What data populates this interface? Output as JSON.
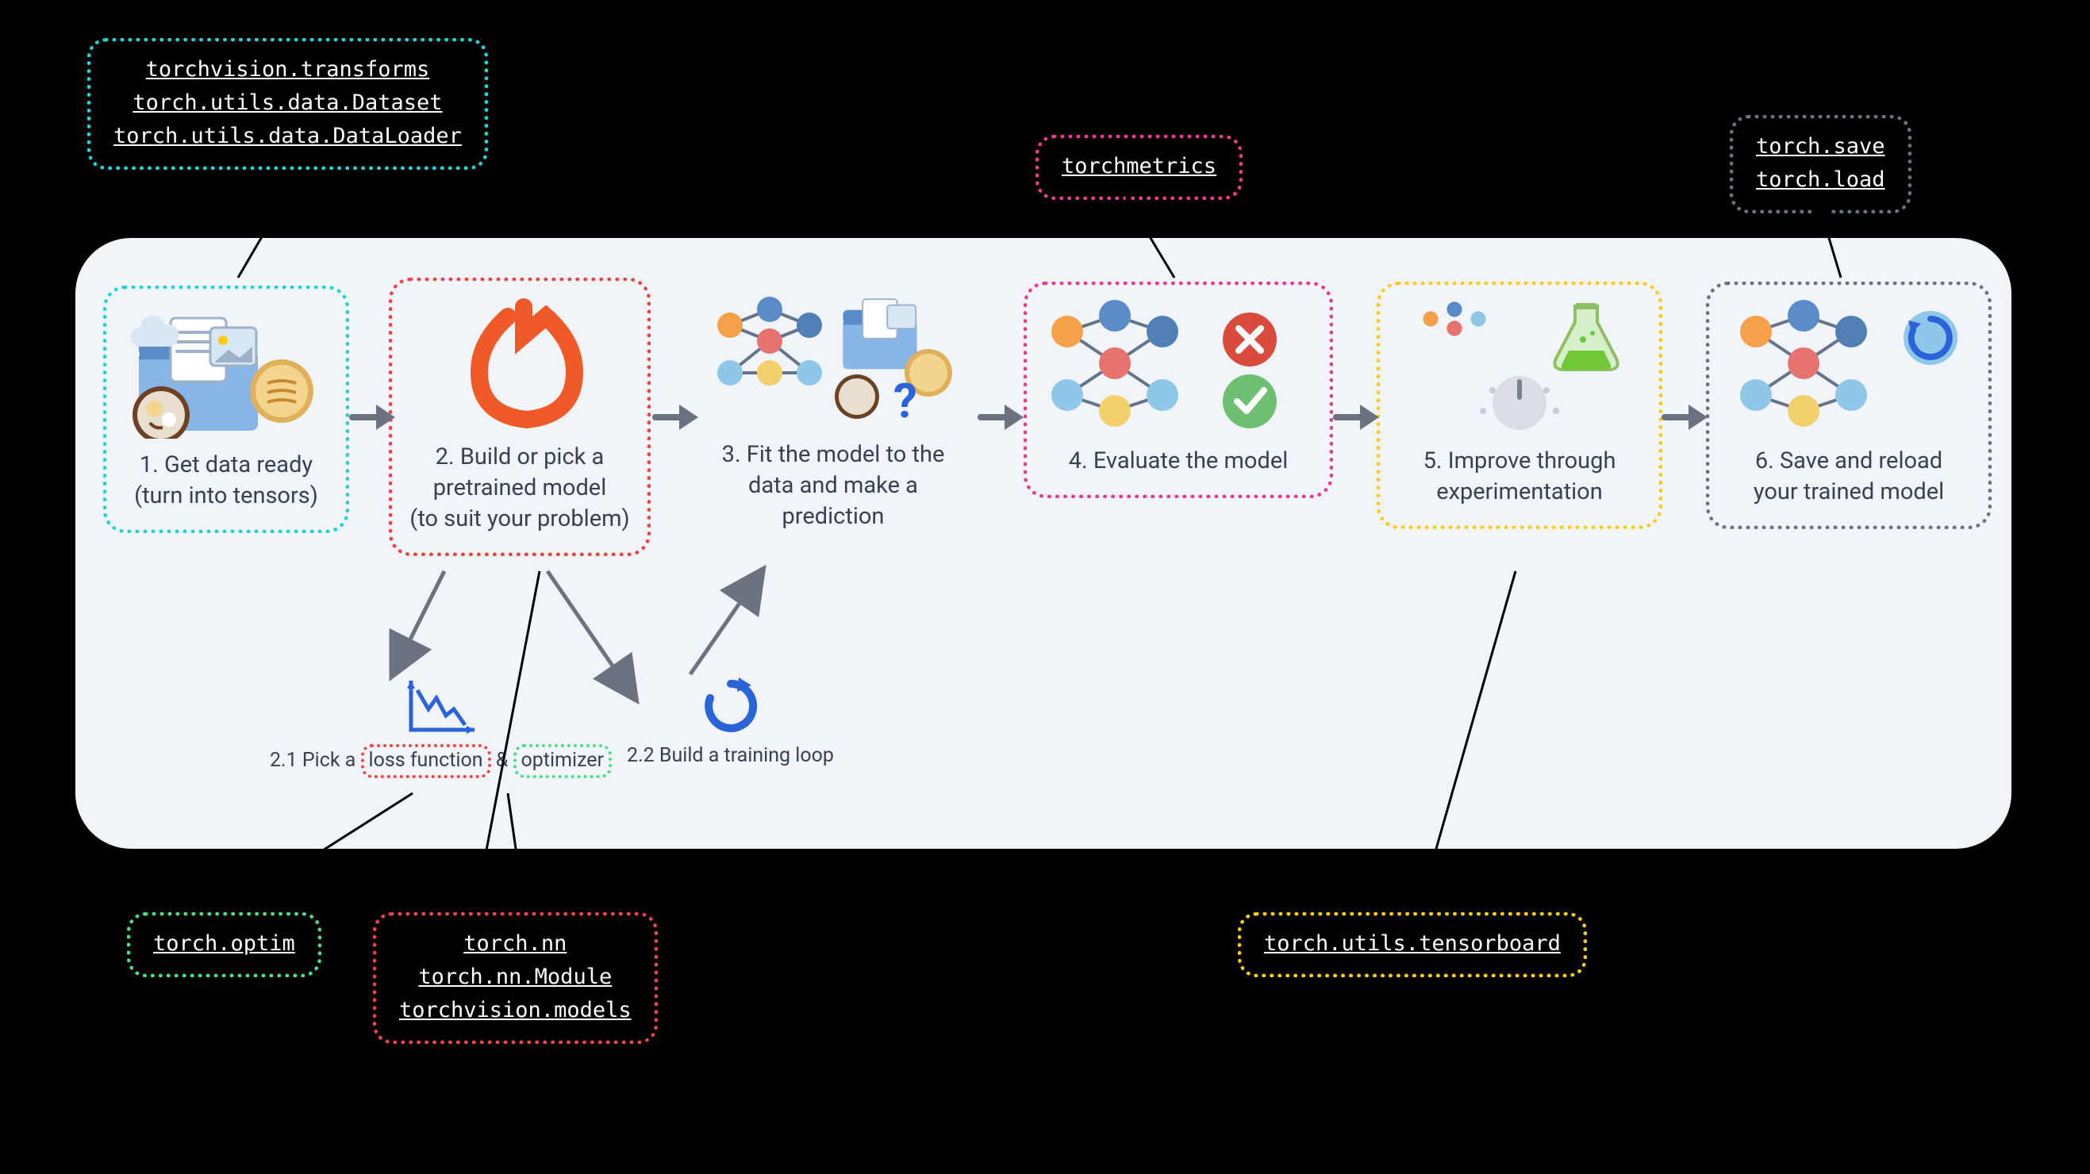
{
  "outer_labels": {
    "data": [
      "torchvision.transforms",
      "torch.utils.data.Dataset",
      "torch.utils.data.DataLoader"
    ],
    "metrics": [
      "torchmetrics"
    ],
    "saveload": [
      "torch.save",
      "torch.load"
    ],
    "optim": [
      "torch.optim"
    ],
    "nn": [
      "torch.nn",
      "torch.nn.Module",
      "torchvision.models"
    ],
    "tboard": [
      "torch.utils.tensorboard"
    ]
  },
  "steps": {
    "s1": {
      "caption": "1. Get data ready\n(turn into tensors)"
    },
    "s2": {
      "caption": "2. Build or pick a\npretrained model\n(to suit your problem)"
    },
    "s3": {
      "caption": "3. Fit the model to the\ndata and make a\nprediction"
    },
    "s4": {
      "caption": "4. Evaluate the model"
    },
    "s5": {
      "caption": "5. Improve through\nexperimentation"
    },
    "s6": {
      "caption": "6. Save and reload\nyour trained model"
    }
  },
  "substeps": {
    "s21_prefix": "2.1 Pick a ",
    "s21_loss": "loss function",
    "s21_amp": " & ",
    "s21_opt": "optimizer",
    "s22": "2.2 Build a training loop"
  },
  "colors": {
    "teal": "#22d3d3",
    "orange": "#f97316",
    "pink": "#eb3a8f",
    "yellow": "#facc15",
    "gray": "#6b7280",
    "green": "#4ade80",
    "red": "#ef4444",
    "blue": "#2a64d8"
  }
}
